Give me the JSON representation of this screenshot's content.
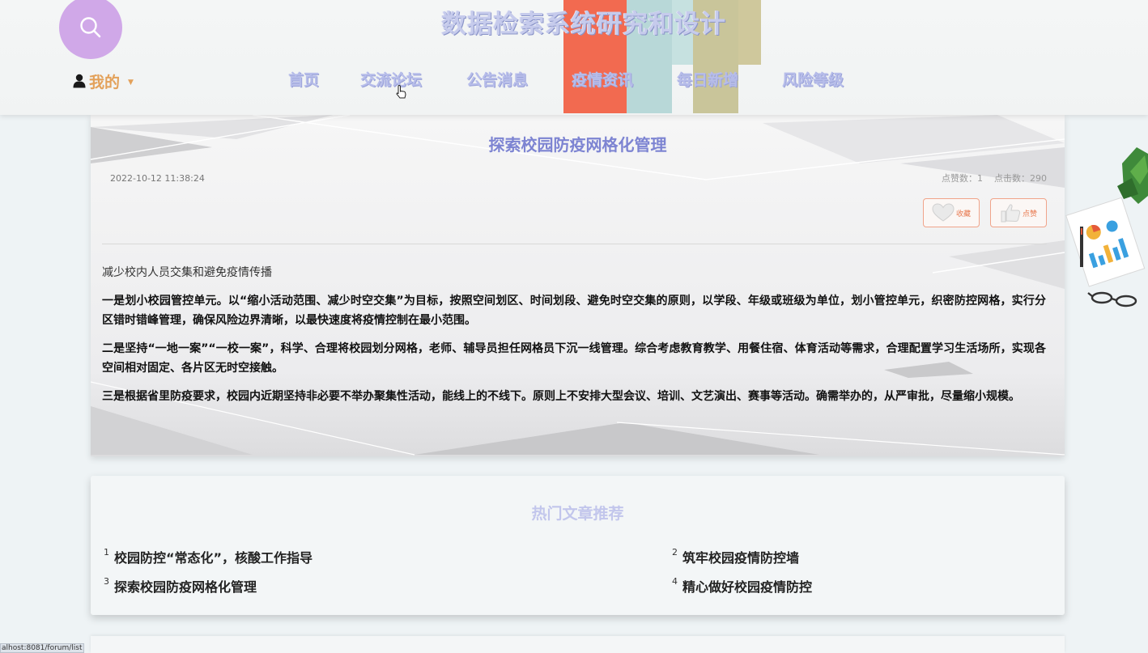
{
  "header": {
    "title": "数据检索系统研究和设计",
    "user_menu_label": "我的",
    "nav": [
      "首页",
      "交流论坛",
      "公告消息",
      "疫情资讯",
      "每日新增",
      "风险等级"
    ]
  },
  "article": {
    "title": "探索校园防疫网格化管理",
    "date": "2022-10-12 11:38:24",
    "likes_label": "点赞数：1",
    "clicks_label": "点击数：290",
    "favorite_label": "收藏",
    "like_label": "点赞",
    "intro": "减少校内人员交集和避免疫情传播",
    "paragraphs": [
      "一是划小校园管控单元。以“缩小活动范围、减少时空交集”为目标，按照空间划区、时间划段、避免时空交集的原则，以学段、年级或班级为单位，划小管控单元，织密防控网格，实行分区错时错峰管理，确保风险边界清晰，以最快速度将疫情控制在最小范围。",
      "二是坚持“一地一案”“一校一案”，科学、合理将校园划分网格，老师、辅导员担任网格员下沉一线管理。综合考虑教育教学、用餐住宿、体育活动等需求，合理配置学习生活场所，实现各空间相对固定、各片区无时空接触。",
      "三是根据省里防疫要求，校园内近期坚持非必要不举办聚集性活动，能线上的不线下。原则上不安排大型会议、培训、文艺演出、赛事等活动。确需举办的，从严审批，尽量缩小规模。"
    ]
  },
  "hot": {
    "title": "热门文章推荐",
    "items": [
      {
        "num": "1",
        "text": "校园防控“常态化”，核酸工作指导"
      },
      {
        "num": "2",
        "text": "筑牢校园疫情防控墙"
      },
      {
        "num": "3",
        "text": "探索校园防疫网格化管理"
      },
      {
        "num": "4",
        "text": "精心做好校园疫情防控"
      }
    ]
  },
  "status_bar": {
    "url": "alhost:8081/forum/list"
  },
  "colors": {
    "accent_purple": "#d0a8e8",
    "title_lavender": "#7d84d2",
    "user_orange": "#e3a15a",
    "button_orange": "#e8794f"
  },
  "icons": [
    "search-icon",
    "user-icon",
    "caret-down-icon",
    "pointer-cursor-icon",
    "heart-icon",
    "thumbs-up-icon"
  ]
}
